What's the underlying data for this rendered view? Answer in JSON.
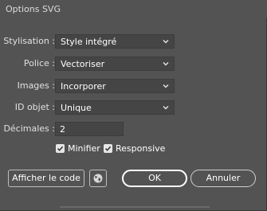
{
  "window": {
    "title": "Options SVG"
  },
  "fields": {
    "stylisation": {
      "label": "Stylisation :",
      "value": "Style intégré"
    },
    "police": {
      "label": "Police :",
      "value": "Vectoriser"
    },
    "images": {
      "label": "Images :",
      "value": "Incorporer"
    },
    "id_objet": {
      "label": "ID objet :",
      "value": "Unique"
    },
    "decimales": {
      "label": "Décimales :",
      "value": "2"
    }
  },
  "checkboxes": {
    "minifier": {
      "label": "Minifier",
      "checked": true
    },
    "responsive": {
      "label": "Responsive",
      "checked": true
    }
  },
  "buttons": {
    "show_code": "Afficher le code",
    "globe_icon": "globe-icon",
    "ok": "OK",
    "cancel": "Annuler"
  }
}
